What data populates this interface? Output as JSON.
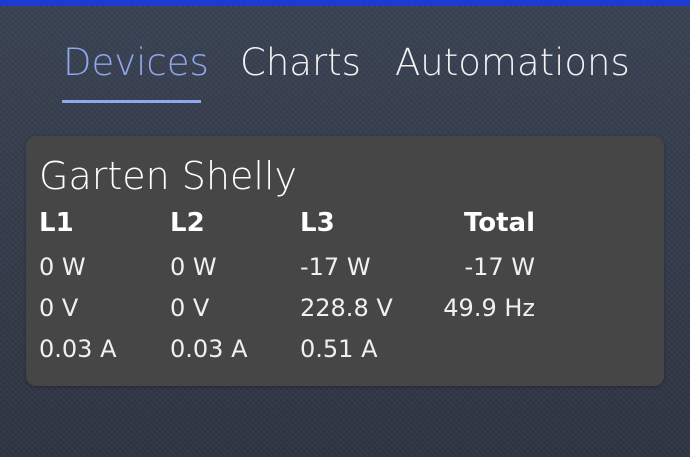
{
  "tabs": [
    {
      "label": "Devices",
      "active": true
    },
    {
      "label": "Charts",
      "active": false
    },
    {
      "label": "Automations",
      "active": false
    }
  ],
  "colors": {
    "accent": "#8fa7ec",
    "top_bar": "#1f3ad1",
    "card_background": "#464646"
  },
  "device": {
    "name": "Garten Shelly",
    "headers": [
      "L1",
      "L2",
      "L3",
      "Total"
    ],
    "rows": [
      [
        "0 W",
        "0 W",
        "-17 W",
        "-17 W"
      ],
      [
        "0 V",
        "0 V",
        "228.8 V",
        "49.9 Hz"
      ],
      [
        "0.03 A",
        "0.03 A",
        "0.51 A",
        ""
      ]
    ]
  }
}
